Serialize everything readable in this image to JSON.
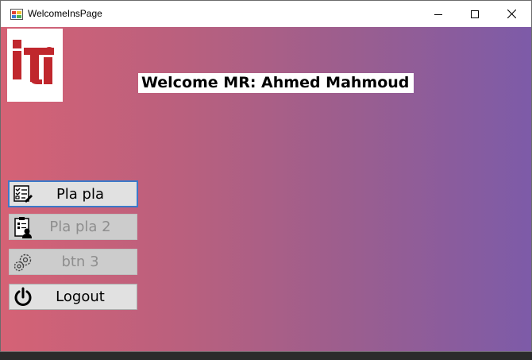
{
  "window": {
    "title": "WelcomeInsPage"
  },
  "header": {
    "welcome_text": "Welcome MR: Ahmed Mahmoud"
  },
  "logo": {
    "text": "iti",
    "color": "#c0272d"
  },
  "menu": {
    "buttons": [
      {
        "label": "Pla pla",
        "icon": "checklist-icon",
        "enabled": true,
        "focused": true
      },
      {
        "label": "Pla pla 2",
        "icon": "clipboard-person-icon",
        "enabled": false
      },
      {
        "label": "btn 3",
        "icon": "gears-icon",
        "enabled": false
      },
      {
        "label": "Logout",
        "icon": "power-icon",
        "enabled": true
      }
    ]
  },
  "theme": {
    "gradient_left": "#d56275",
    "gradient_right": "#7d5ba8",
    "focus_border": "#3b79c9"
  }
}
